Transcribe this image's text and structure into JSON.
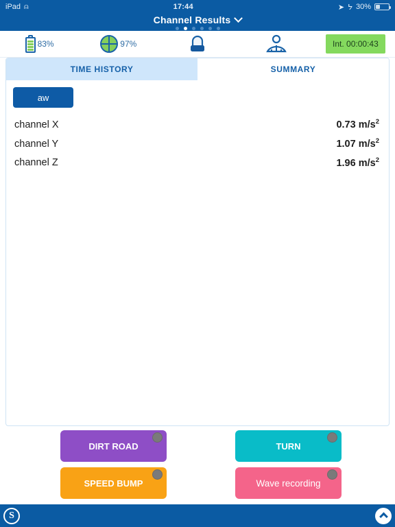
{
  "status_bar": {
    "device": "iPad",
    "wifi_icon": "wifi-icon",
    "time": "17:44",
    "location_icon": "location-arrow-icon",
    "bluetooth_icon": "bluetooth-icon",
    "battery_percent": "30%",
    "battery_level": 30
  },
  "title_bar": {
    "title": "Channel Results",
    "dropdown_icon": "chevron-down-icon",
    "page_count": 6,
    "active_page": 2
  },
  "toolbar": {
    "battery": {
      "icon": "battery-icon",
      "value": "83%",
      "level": 83
    },
    "storage": {
      "icon": "disk-pie-icon",
      "value": "97%",
      "level": 97
    },
    "alarm": {
      "icon": "siren-beacon-icon"
    },
    "wbv": {
      "icon": "seated-person-icon"
    },
    "timer_badge": {
      "label": "Int. 00:00:43",
      "color": "#84d95e"
    }
  },
  "panel": {
    "tabs": [
      {
        "label": "TIME HISTORY",
        "active": true
      },
      {
        "label": "SUMMARY",
        "active": false
      }
    ],
    "weighting_button": "aw",
    "channels": [
      {
        "name": "channel X",
        "value": "0.73",
        "unit": "m/s",
        "exponent": "2"
      },
      {
        "name": "channel Y",
        "value": "1.07",
        "unit": "m/s",
        "exponent": "2"
      },
      {
        "name": "channel Z",
        "value": "1.96",
        "unit": "m/s",
        "exponent": "2"
      }
    ]
  },
  "events": [
    {
      "label": "DIRT ROAD",
      "color": "#8e4ec6",
      "indicator": "#7a7a7a"
    },
    {
      "label": "TURN",
      "color": "#09bcc8",
      "indicator": "#7a7a7a"
    },
    {
      "label": "SPEED BUMP",
      "color": "#f9a215",
      "indicator": "#7a7a7a"
    },
    {
      "label": "Wave recording",
      "color": "#f4648a",
      "indicator": "#7a7a7a"
    }
  ],
  "bottom_bar": {
    "logo": "S",
    "logo_icon": "svantek-logo-icon",
    "expand_icon": "chevron-up-icon"
  }
}
